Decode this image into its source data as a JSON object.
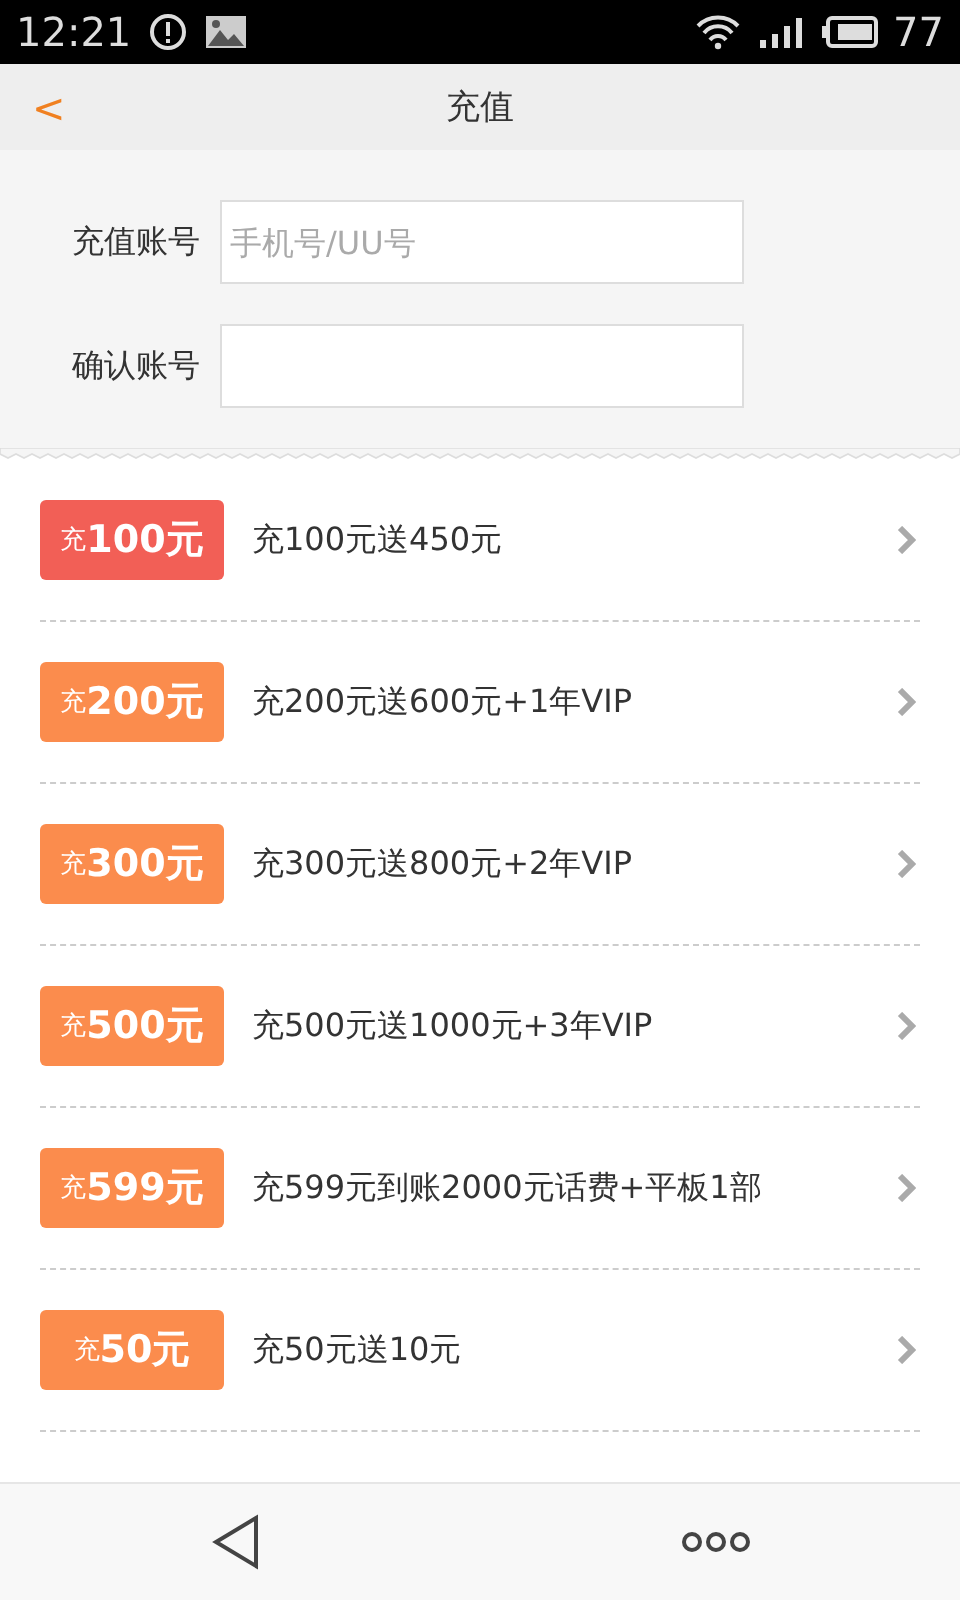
{
  "status_bar": {
    "time": "12:21",
    "battery": "77"
  },
  "header": {
    "back": "<",
    "title": "充值"
  },
  "form": {
    "fields": [
      {
        "label": "充值账号",
        "placeholder": "手机号/UU号"
      },
      {
        "label": "确认账号"
      }
    ]
  },
  "offers": [
    {
      "badge": "充**100元**",
      "description": "充100元送450元",
      "selected": true
    },
    {
      "badge": "充**200元**",
      "description": "充200元送600元+1年VIP",
      "selected": false
    },
    {
      "badge": "充**300元**",
      "description": "充300元送800元+2年VIP",
      "selected": false
    },
    {
      "badge": "充**500元**",
      "description": "充500元送1000元+3年VIP",
      "selected": false
    },
    {
      "badge": "充**599元**",
      "description": "充599元到账2000元话费+平板1部",
      "selected": false
    },
    {
      "badge": "充**50元**",
      "description": "充50元送10元",
      "selected": false
    }
  ]
}
